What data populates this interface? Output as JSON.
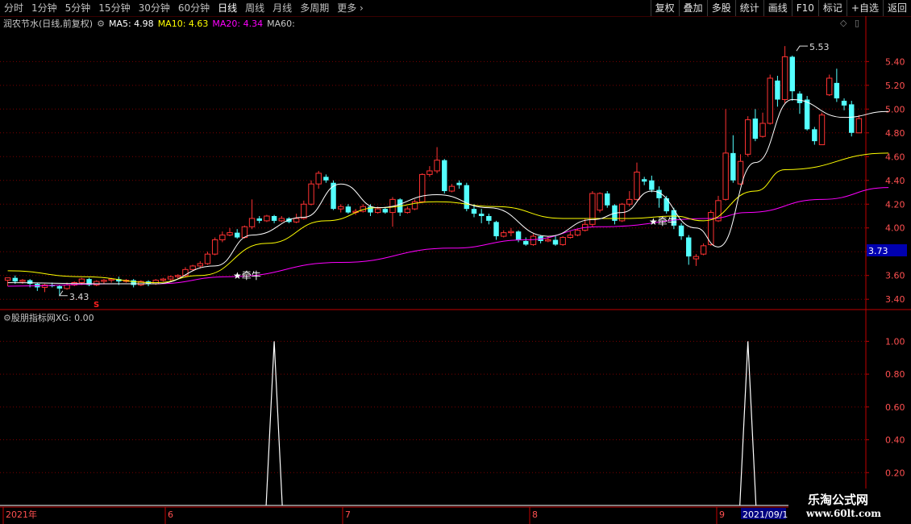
{
  "toolbar": {
    "periods": [
      "分时",
      "1分钟",
      "5分钟",
      "15分钟",
      "30分钟",
      "60分钟",
      "日线",
      "周线",
      "月线",
      "多周期"
    ],
    "active_period": "日线",
    "more_label": "更多 ›",
    "buttons": [
      "复权",
      "叠加",
      "多股",
      "统计",
      "画线",
      "F10",
      "标记",
      "+自选",
      "返回"
    ]
  },
  "info": {
    "stock_name": "润农节水(日线,前复权)",
    "ma5": "MA5: 4.98",
    "ma10": "MA10: 4.63",
    "ma20": "MA20: 4.34",
    "ma60": "MA60:"
  },
  "indicator_info": {
    "name": "股朋指标网",
    "xg": "XG: 0.00"
  },
  "colors": {
    "up": "#ff3232",
    "down": "#54ffff",
    "ma5": "#ffffff",
    "ma10": "#ffff00",
    "ma20": "#ff00ff",
    "grid": "#7a0000",
    "axis": "#c00000",
    "price_tag_bg": "#0000b0",
    "date_tag_bg": "#000080"
  },
  "price_axis": {
    "ticks": [
      "5.40",
      "5.20",
      "5.00",
      "4.80",
      "4.60",
      "4.40",
      "4.20",
      "4.00",
      "3.80",
      "3.60",
      "3.40"
    ],
    "current_tag": "3.73"
  },
  "indicator_axis": {
    "ticks": [
      "1.00",
      "0.80",
      "0.60",
      "0.40",
      "0.20"
    ]
  },
  "x_axis": {
    "labels": [
      "2021年",
      "6",
      "7",
      "8",
      "9"
    ],
    "current_date": "2021/09/1"
  },
  "annotations": {
    "high_label": "5.53",
    "low_label": "3.43",
    "signal_label_1": "★牵牛",
    "signal_label_2": "★牵牛",
    "s_marker": "S"
  },
  "watermark": {
    "line1": "乐淘公式网",
    "line2": "www.60lt.com"
  },
  "chart_data": {
    "type": "candlestick",
    "price_ylim": [
      3.32,
      5.66
    ],
    "candles": [
      [
        3.56,
        3.58,
        3.51,
        3.58
      ],
      [
        3.58,
        3.55,
        3.53,
        3.6
      ],
      [
        3.55,
        3.56,
        3.53,
        3.57
      ],
      [
        3.56,
        3.53,
        3.5,
        3.57
      ],
      [
        3.53,
        3.5,
        3.47,
        3.54
      ],
      [
        3.5,
        3.52,
        3.46,
        3.53
      ],
      [
        3.52,
        3.51,
        3.5,
        3.54
      ],
      [
        3.51,
        3.49,
        3.43,
        3.52
      ],
      [
        3.49,
        3.52,
        3.48,
        3.54
      ],
      [
        3.52,
        3.54,
        3.51,
        3.55
      ],
      [
        3.54,
        3.57,
        3.52,
        3.58
      ],
      [
        3.57,
        3.52,
        3.51,
        3.58
      ],
      [
        3.52,
        3.55,
        3.51,
        3.56
      ],
      [
        3.55,
        3.56,
        3.53,
        3.57
      ],
      [
        3.56,
        3.57,
        3.54,
        3.58
      ],
      [
        3.57,
        3.55,
        3.52,
        3.59
      ],
      [
        3.55,
        3.56,
        3.54,
        3.57
      ],
      [
        3.56,
        3.52,
        3.5,
        3.57
      ],
      [
        3.52,
        3.55,
        3.51,
        3.56
      ],
      [
        3.55,
        3.53,
        3.51,
        3.56
      ],
      [
        3.53,
        3.56,
        3.52,
        3.57
      ],
      [
        3.56,
        3.57,
        3.55,
        3.58
      ],
      [
        3.57,
        3.59,
        3.56,
        3.6
      ],
      [
        3.59,
        3.6,
        3.57,
        3.61
      ],
      [
        3.6,
        3.65,
        3.59,
        3.67
      ],
      [
        3.65,
        3.68,
        3.64,
        3.69
      ],
      [
        3.68,
        3.7,
        3.66,
        3.72
      ],
      [
        3.7,
        3.78,
        3.69,
        3.8
      ],
      [
        3.78,
        3.9,
        3.77,
        3.92
      ],
      [
        3.9,
        3.94,
        3.88,
        3.97
      ],
      [
        3.94,
        3.96,
        3.93,
        4.0
      ],
      [
        3.96,
        3.92,
        3.91,
        3.99
      ],
      [
        3.92,
        4.01,
        3.91,
        4.02
      ],
      [
        4.01,
        4.08,
        3.99,
        4.24
      ],
      [
        4.08,
        4.06,
        4.04,
        4.1
      ],
      [
        4.06,
        4.1,
        4.05,
        4.11
      ],
      [
        4.1,
        4.06,
        4.04,
        4.11
      ],
      [
        4.06,
        4.08,
        4.05,
        4.1
      ],
      [
        4.08,
        4.05,
        4.04,
        4.09
      ],
      [
        4.05,
        4.08,
        4.04,
        4.12
      ],
      [
        4.08,
        4.2,
        4.07,
        4.23
      ],
      [
        4.2,
        4.37,
        4.19,
        4.4
      ],
      [
        4.37,
        4.46,
        4.33,
        4.48
      ],
      [
        4.43,
        4.4,
        4.38,
        4.45
      ],
      [
        4.38,
        4.16,
        4.15,
        4.4
      ],
      [
        4.16,
        4.18,
        4.13,
        4.2
      ],
      [
        4.18,
        4.13,
        4.12,
        4.2
      ],
      [
        4.13,
        4.14,
        4.11,
        4.16
      ],
      [
        4.14,
        4.18,
        4.13,
        4.2
      ],
      [
        4.18,
        4.13,
        4.1,
        4.2
      ],
      [
        4.13,
        4.16,
        4.12,
        4.18
      ],
      [
        4.16,
        4.13,
        4.12,
        4.17
      ],
      [
        4.13,
        4.24,
        4.01,
        4.26
      ],
      [
        4.24,
        4.13,
        4.1,
        4.25
      ],
      [
        4.13,
        4.16,
        4.12,
        4.18
      ],
      [
        4.16,
        4.22,
        4.15,
        4.24
      ],
      [
        4.22,
        4.45,
        4.21,
        4.46
      ],
      [
        4.45,
        4.48,
        4.43,
        4.52
      ],
      [
        4.48,
        4.57,
        4.46,
        4.68
      ],
      [
        4.57,
        4.31,
        4.29,
        4.58
      ],
      [
        4.31,
        4.35,
        4.3,
        4.37
      ],
      [
        4.38,
        4.36,
        4.33,
        4.4
      ],
      [
        4.36,
        4.16,
        4.14,
        4.38
      ],
      [
        4.16,
        4.12,
        4.09,
        4.2
      ],
      [
        4.12,
        4.1,
        4.04,
        4.16
      ],
      [
        4.1,
        4.06,
        4.03,
        4.12
      ],
      [
        4.05,
        3.93,
        3.9,
        4.06
      ],
      [
        3.93,
        3.96,
        3.92,
        3.98
      ],
      [
        3.96,
        3.97,
        3.93,
        4.0
      ],
      [
        3.97,
        3.9,
        3.88,
        3.98
      ],
      [
        3.89,
        3.86,
        3.85,
        3.92
      ],
      [
        3.86,
        3.93,
        3.85,
        3.95
      ],
      [
        3.93,
        3.89,
        3.87,
        3.94
      ],
      [
        3.89,
        3.9,
        3.88,
        3.93
      ],
      [
        3.9,
        3.86,
        3.85,
        3.94
      ],
      [
        3.86,
        3.92,
        3.85,
        3.93
      ],
      [
        3.92,
        3.94,
        3.91,
        3.97
      ],
      [
        3.94,
        3.98,
        3.93,
        3.99
      ],
      [
        3.98,
        4.03,
        3.97,
        4.08
      ],
      [
        4.03,
        4.29,
        4.01,
        4.31
      ],
      [
        4.15,
        4.29,
        4.13,
        4.3
      ],
      [
        4.29,
        4.19,
        4.17,
        4.31
      ],
      [
        4.19,
        4.06,
        4.03,
        4.2
      ],
      [
        4.06,
        4.2,
        4.05,
        4.21
      ],
      [
        4.2,
        4.24,
        4.18,
        4.31
      ],
      [
        4.24,
        4.47,
        4.23,
        4.55
      ],
      [
        4.41,
        4.39,
        4.36,
        4.43
      ],
      [
        4.4,
        4.32,
        4.3,
        4.44
      ],
      [
        4.32,
        4.25,
        4.17,
        4.35
      ],
      [
        4.25,
        4.14,
        4.12,
        4.27
      ],
      [
        4.15,
        4.02,
        3.99,
        4.17
      ],
      [
        4.02,
        3.93,
        3.9,
        4.04
      ],
      [
        3.92,
        3.76,
        3.69,
        3.94
      ],
      [
        3.74,
        3.76,
        3.68,
        3.78
      ],
      [
        3.78,
        3.85,
        3.77,
        3.87
      ],
      [
        3.86,
        4.13,
        3.85,
        4.15
      ],
      [
        4.06,
        4.23,
        4.05,
        4.27
      ],
      [
        4.24,
        4.63,
        4.23,
        5.0
      ],
      [
        4.63,
        4.4,
        4.38,
        4.78
      ],
      [
        4.37,
        4.56,
        4.36,
        4.62
      ],
      [
        4.62,
        4.91,
        4.6,
        4.94
      ],
      [
        4.92,
        4.75,
        4.73,
        5.0
      ],
      [
        4.77,
        4.88,
        4.76,
        4.97
      ],
      [
        4.88,
        5.26,
        4.87,
        5.29
      ],
      [
        5.24,
        5.08,
        5.02,
        5.28
      ],
      [
        5.08,
        5.44,
        5.05,
        5.53
      ],
      [
        5.44,
        5.15,
        5.07,
        5.45
      ],
      [
        5.13,
        5.05,
        4.96,
        5.15
      ],
      [
        5.08,
        4.83,
        4.82,
        5.11
      ],
      [
        4.83,
        4.73,
        4.7,
        4.85
      ],
      [
        4.7,
        4.95,
        4.7,
        4.97
      ],
      [
        5.12,
        5.26,
        5.11,
        5.29
      ],
      [
        5.22,
        5.09,
        5.06,
        5.34
      ],
      [
        5.07,
        5.03,
        4.99,
        5.09
      ],
      [
        5.04,
        4.8,
        4.77,
        5.07
      ],
      [
        4.8,
        4.92,
        4.8,
        4.95
      ]
    ],
    "ma5_anchor": [
      [
        3.54,
        0
      ],
      [
        3.53,
        12
      ],
      [
        3.53,
        20
      ],
      [
        3.68,
        28
      ],
      [
        3.94,
        33
      ],
      [
        4.09,
        40
      ],
      [
        4.37,
        45
      ],
      [
        4.17,
        50
      ],
      [
        4.28,
        58
      ],
      [
        4.17,
        65
      ],
      [
        3.93,
        73
      ],
      [
        4.07,
        79
      ],
      [
        4.13,
        83
      ],
      [
        4.31,
        87
      ],
      [
        4.0,
        93
      ],
      [
        3.84,
        96
      ],
      [
        4.55,
        101
      ],
      [
        5.08,
        106
      ],
      [
        4.93,
        113
      ],
      [
        4.98,
        119
      ]
    ],
    "ma10_anchor": [
      [
        3.64,
        0
      ],
      [
        3.59,
        10
      ],
      [
        3.54,
        20
      ],
      [
        3.6,
        26
      ],
      [
        3.87,
        35
      ],
      [
        4.06,
        43
      ],
      [
        4.17,
        50
      ],
      [
        4.22,
        58
      ],
      [
        4.18,
        66
      ],
      [
        4.08,
        75
      ],
      [
        4.08,
        84
      ],
      [
        4.1,
        90
      ],
      [
        4.06,
        94
      ],
      [
        4.31,
        101
      ],
      [
        4.49,
        105
      ],
      [
        4.63,
        119
      ]
    ],
    "ma20_anchor": [
      [
        3.51,
        0
      ],
      [
        3.53,
        15
      ],
      [
        3.53,
        20
      ],
      [
        3.59,
        30
      ],
      [
        3.71,
        45
      ],
      [
        3.83,
        60
      ],
      [
        3.9,
        70
      ],
      [
        4.01,
        80
      ],
      [
        4.08,
        95
      ],
      [
        4.13,
        100
      ],
      [
        4.24,
        110
      ],
      [
        4.34,
        119
      ]
    ],
    "xg_peaks": [
      36,
      100
    ],
    "indicator_ylim": [
      0,
      1.1
    ]
  }
}
